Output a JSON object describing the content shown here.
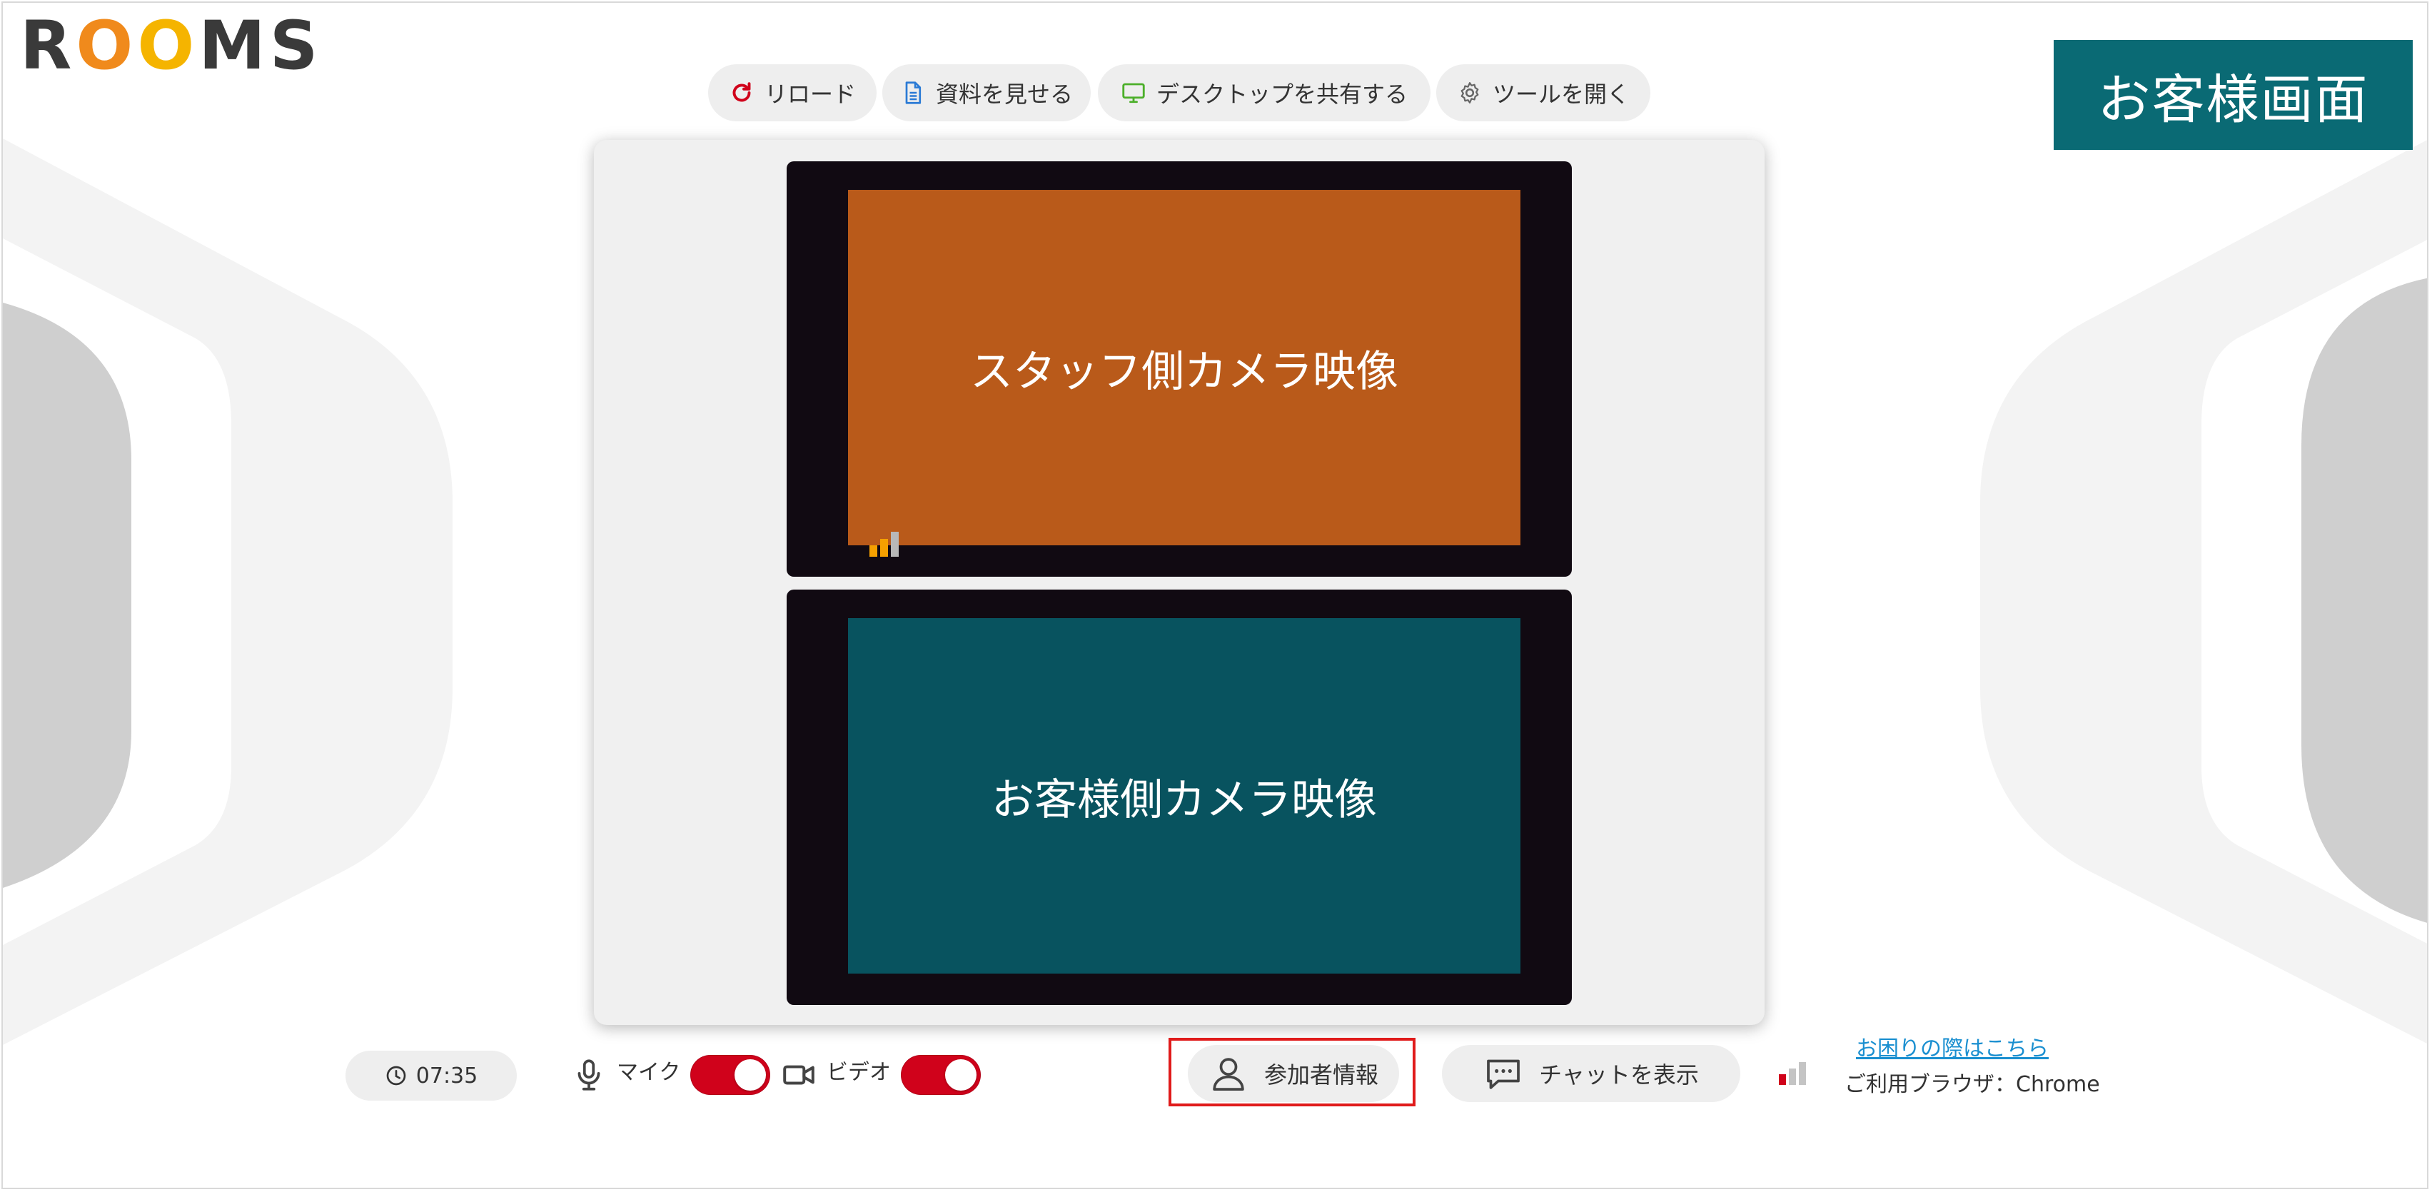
{
  "app": {
    "logo_letters": [
      "R",
      "O",
      "O",
      "M",
      "S"
    ],
    "logo_colors": [
      "#3a3a3a",
      "#f08a1c",
      "#f5b400",
      "#3a3a3a",
      "#3a3a3a"
    ],
    "screen_label": "お客様画面"
  },
  "toolbar": {
    "reload": "リロード",
    "show_documents": "資料を見せる",
    "share_desktop": "デスクトップを共有する",
    "open_tools": "ツールを開く"
  },
  "video": {
    "staff_label": "スタッフ側カメラ映像",
    "customer_label": "お客様側カメラ映像"
  },
  "bottom": {
    "timer": "07:35",
    "mic_label": "マイク",
    "mic_on": true,
    "video_label": "ビデオ",
    "video_on": true,
    "participants_button": "参加者情報",
    "chat_button": "チャットを表示",
    "help_link": "お困りの際はこちら",
    "browser_info": "ご利用ブラウザ：Chrome"
  },
  "colors": {
    "accent_red": "#d0021b",
    "customer_tag": "#0a6a74",
    "staff_video": "#b95a1a",
    "customer_video": "#08535f",
    "link": "#1a8fd0",
    "highlight": "#e01b1b"
  },
  "icons": {
    "reload": "reload-icon",
    "documents": "document-icon",
    "desktop": "monitor-icon",
    "tools": "gear-icon",
    "timer": "clock-icon",
    "mic": "microphone-icon",
    "video": "video-camera-icon",
    "participants": "person-icon",
    "chat": "chat-bubble-icon",
    "signal": "signal-bars-icon"
  }
}
